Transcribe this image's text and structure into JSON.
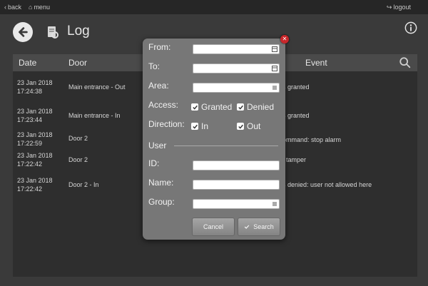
{
  "topbar": {
    "back": "back",
    "menu": "menu",
    "logout": "logout"
  },
  "header": {
    "title": "Log"
  },
  "table": {
    "columns": {
      "date": "Date",
      "door": "Door",
      "event": "Event"
    },
    "rows": [
      {
        "date": "23 Jan 2018",
        "time": "17:24:38",
        "door": "Main entrance - Out",
        "event": "s granted"
      },
      {
        "date": "23 Jan 2018",
        "time": "17:23:44",
        "door": "Main entrance - In",
        "event": "s granted"
      },
      {
        "date": "23 Jan 2018",
        "time": "17:22:59",
        "door": "Door 2",
        "event": "al command: stop alarm"
      },
      {
        "date": "23 Jan 2018",
        "time": "17:22:42",
        "door": "Door 2",
        "event": ": tamper"
      },
      {
        "date": "23 Jan 2018",
        "time": "17:22:42",
        "door": "Door 2 - In",
        "event": "s denied: user not allowed here"
      }
    ]
  },
  "filter": {
    "from_label": "From:",
    "to_label": "To:",
    "area_label": "Area:",
    "access_label": "Access:",
    "granted_label": "Granted",
    "denied_label": "Denied",
    "direction_label": "Direction:",
    "in_label": "In",
    "out_label": "Out",
    "user_section": "User",
    "id_label": "ID:",
    "name_label": "Name:",
    "group_label": "Group:",
    "cancel_label": "Cancel",
    "search_label": "Search",
    "granted_checked": true,
    "denied_checked": true,
    "in_checked": true,
    "out_checked": true
  },
  "icons": {
    "back": "arrow-left-icon",
    "log": "log-icon",
    "info": "info-icon",
    "search": "search-icon",
    "close": "close-icon"
  },
  "colors": {
    "close": "#c8262a",
    "background": "#3a3a3a"
  }
}
